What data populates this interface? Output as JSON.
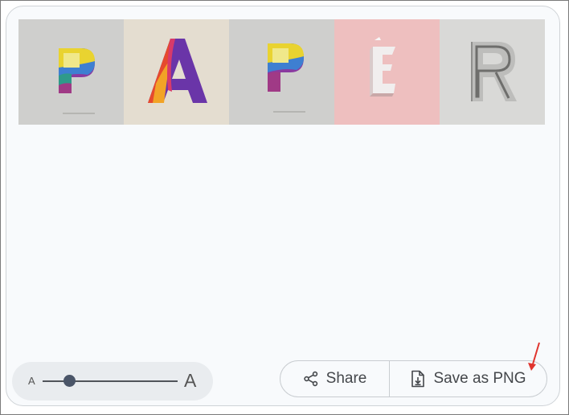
{
  "gallery": {
    "letters": [
      "P",
      "A",
      "P",
      "E",
      "R"
    ]
  },
  "font_size_slider": {
    "small_label": "A",
    "large_label": "A",
    "level": 0.2
  },
  "actions": {
    "share_label": "Share",
    "save_label": "Save as PNG"
  },
  "icons": [
    "share-icon",
    "file-download-icon"
  ],
  "colors": {
    "card_background": "#f8fafc",
    "annotation_arrow": "#e0342e"
  }
}
